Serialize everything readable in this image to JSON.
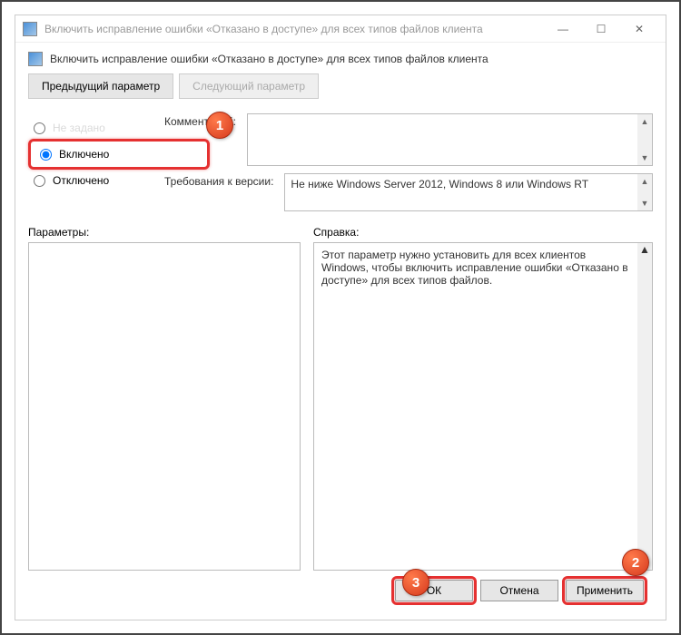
{
  "titlebar": {
    "text": "Включить исправление ошибки «Отказано в доступе» для всех типов файлов клиента"
  },
  "header": {
    "text": "Включить исправление ошибки «Отказано в доступе» для всех типов файлов клиента"
  },
  "nav": {
    "prev": "Предыдущий параметр",
    "next": "Следующий параметр"
  },
  "radios": {
    "not_configured": "Не задано",
    "enabled": "Включено",
    "disabled": "Отключено"
  },
  "labels": {
    "comment": "Комментарий:",
    "requirements": "Требования к версии:",
    "options": "Параметры:",
    "help": "Справка:"
  },
  "requirements": {
    "text": "Не ниже Windows Server 2012, Windows 8 или Windows RT"
  },
  "help": {
    "text": "Этот параметр нужно установить для всех клиентов Windows, чтобы включить исправление ошибки «Отказано в доступе» для всех типов файлов."
  },
  "buttons": {
    "ok": "ОК",
    "cancel": "Отмена",
    "apply": "Применить"
  },
  "badges": {
    "one": "1",
    "two": "2",
    "three": "3"
  }
}
